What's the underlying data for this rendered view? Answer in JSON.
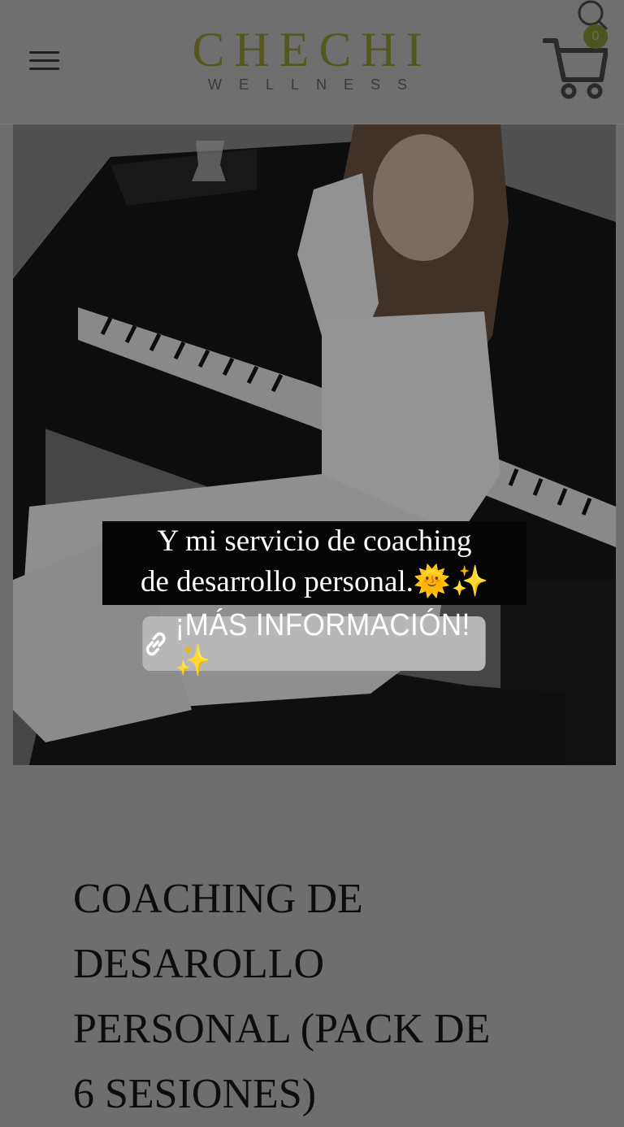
{
  "header": {
    "brand": "CHECHI",
    "tagline": "WELLNESS",
    "menu_icon": "hamburger-menu-icon",
    "search_icon": "search-icon",
    "cart_icon": "shopping-cart-icon",
    "cart_count": "0"
  },
  "story": {
    "caption_line1": "Y mi servicio de coaching",
    "caption_line2": "de desarrollo personal.🌞✨",
    "link_label": "¡MÁS INFORMACIÓN!✨",
    "link_icon": "link-icon"
  },
  "product": {
    "title": "COACHING DE\nDESAROLLO\nPERSONAL (PACK DE\n6 SESIONES)"
  },
  "colors": {
    "brand_olive": "#55581c",
    "overlay_grey": "#6e6e6e",
    "button_grey": "#b7b7b7"
  }
}
